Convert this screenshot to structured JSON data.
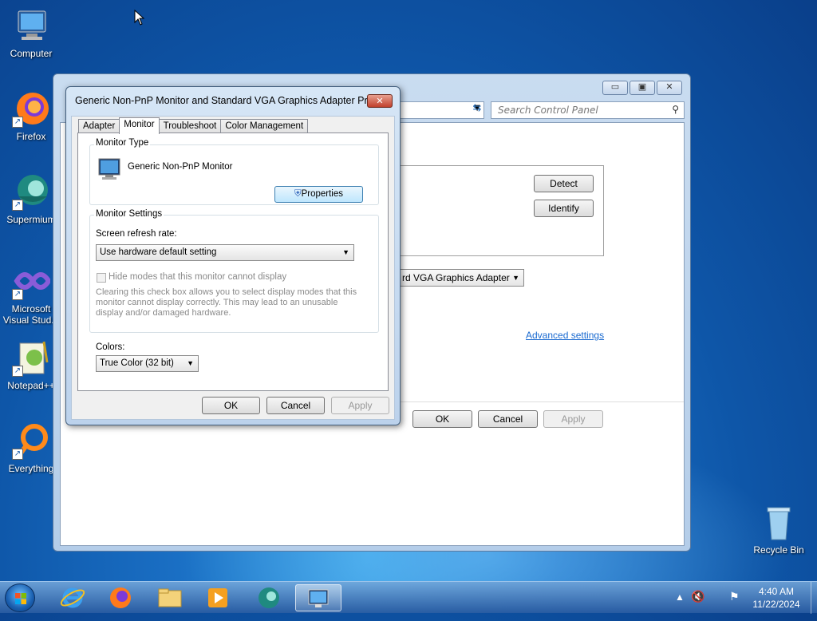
{
  "desktop": {
    "icons": [
      {
        "label": "Computer",
        "icon": "computer-icon"
      },
      {
        "label": "Firefox",
        "icon": "firefox-icon"
      },
      {
        "label": "Supermium",
        "icon": "supermium-icon"
      },
      {
        "label": "Microsoft Visual Stud...",
        "icon": "visual-studio-icon"
      },
      {
        "label": "Notepad++",
        "icon": "notepad-plus-plus-icon"
      },
      {
        "label": "Everything",
        "icon": "everything-icon"
      },
      {
        "label": "Recycle Bin",
        "icon": "recycle-bin-icon"
      }
    ]
  },
  "control_panel": {
    "search_placeholder": "Search Control Panel",
    "detect_label": "Detect",
    "identify_label": "Identify",
    "adapter_combo": "rd VGA Graphics Adapter",
    "advanced_link": "Advanced settings",
    "ok_label": "OK",
    "cancel_label": "Cancel",
    "apply_label": "Apply"
  },
  "dialog": {
    "title": "Generic Non-PnP Monitor and Standard VGA Graphics Adapter Pro...",
    "close_label": "✕",
    "tabs": [
      "Adapter",
      "Monitor",
      "Troubleshoot",
      "Color Management"
    ],
    "active_tab": "Monitor",
    "monitor_type_label": "Monitor Type",
    "monitor_name": "Generic Non-PnP Monitor",
    "properties_label": "Properties",
    "monitor_settings_label": "Monitor Settings",
    "refresh_rate_label": "Screen refresh rate:",
    "refresh_rate_value": "Use hardware default setting",
    "hide_modes_label": "Hide modes that this monitor cannot display",
    "hide_modes_desc": "Clearing this check box allows you to select display modes that this monitor cannot display correctly. This may lead to an unusable display and/or damaged hardware.",
    "colors_label": "Colors:",
    "colors_value": "True Color (32 bit)",
    "ok_label": "OK",
    "cancel_label": "Cancel",
    "apply_label": "Apply"
  },
  "taskbar": {
    "items": [
      "internet-explorer-icon",
      "firefox-icon",
      "file-explorer-icon",
      "media-player-icon",
      "supermium-icon",
      "display-settings-icon"
    ],
    "time": "4:40 AM",
    "date": "11/22/2024"
  }
}
